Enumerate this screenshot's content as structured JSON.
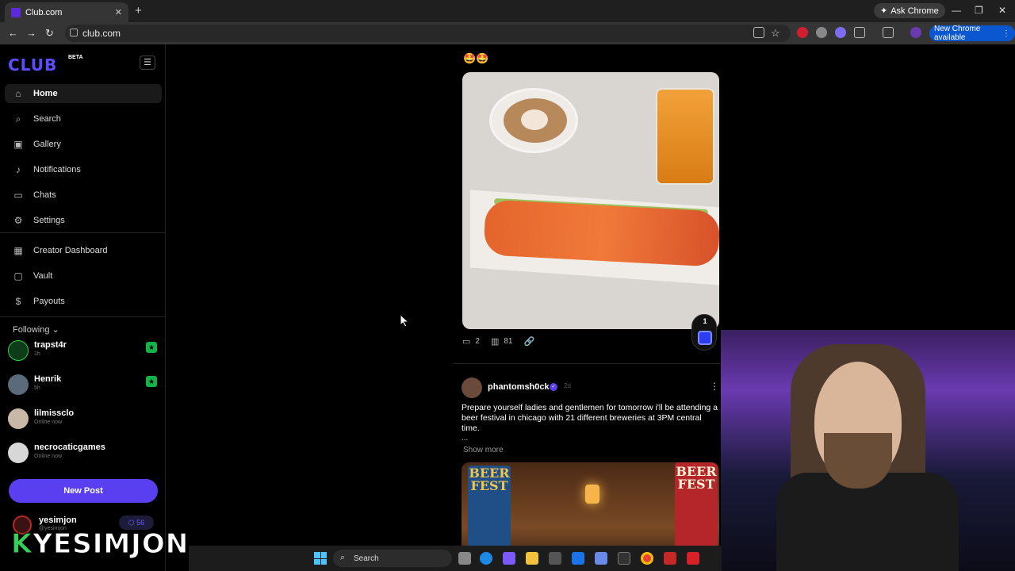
{
  "browser": {
    "tab_title": "Club.com",
    "tab_close": "✕",
    "new_tab": "+",
    "ask_chrome": "Ask Chrome",
    "url": "club.com",
    "new_chrome": "New Chrome available",
    "window_controls": [
      "—",
      "❐",
      "✕"
    ]
  },
  "sidebar": {
    "logo": "CLUB",
    "beta": "BETA",
    "nav": [
      {
        "label": "Home",
        "icon": "home-icon",
        "glyph": "⌂"
      },
      {
        "label": "Search",
        "icon": "search-icon",
        "glyph": "⌕"
      },
      {
        "label": "Gallery",
        "icon": "gallery-icon",
        "glyph": "▣"
      },
      {
        "label": "Notifications",
        "icon": "bell-icon",
        "glyph": "♪"
      },
      {
        "label": "Chats",
        "icon": "chat-icon",
        "glyph": "▭"
      },
      {
        "label": "Settings",
        "icon": "gear-icon",
        "glyph": "⚙"
      },
      {
        "label": "Creator Dashboard",
        "icon": "dashboard-icon",
        "glyph": "▦"
      },
      {
        "label": "Vault",
        "icon": "vault-icon",
        "glyph": "▢"
      },
      {
        "label": "Payouts",
        "icon": "payouts-icon",
        "glyph": "$"
      }
    ],
    "following_label": "Following",
    "following": [
      {
        "name": "trapst4r",
        "sub": "1h",
        "starred": true,
        "color": "#0e3b1a"
      },
      {
        "name": "Henrik",
        "sub": "5h",
        "starred": true,
        "color": "#5a6a7a"
      },
      {
        "name": "lilmissclo",
        "sub": "Online now",
        "starred": false,
        "color": "#c9b8a8"
      },
      {
        "name": "necrocaticgames",
        "sub": "Online now",
        "starred": false,
        "color": "#d7d7d7"
      }
    ],
    "new_post": "New Post",
    "me": {
      "name": "yesimjon",
      "handle": "@yesimjon",
      "points": "56"
    }
  },
  "feed": {
    "emoji": "🤩🤩",
    "post1": {
      "comments": "2",
      "views": "81",
      "badge_count": "1"
    },
    "post2": {
      "author": "phantomsh0ck",
      "time": "2d",
      "text": "Prepare yourself ladies and gentlemen for tomorrow i'll be attending a beer festival in chicago with 21 different breweries at 3PM central time.",
      "ellipsis": "...",
      "show_more": "Show more",
      "sign_left": "BEER FEST",
      "sign_right": "BEER FEST"
    }
  },
  "overlay": {
    "k": "K",
    "name": "YESIMJON"
  },
  "taskbar": {
    "search": "Search"
  }
}
